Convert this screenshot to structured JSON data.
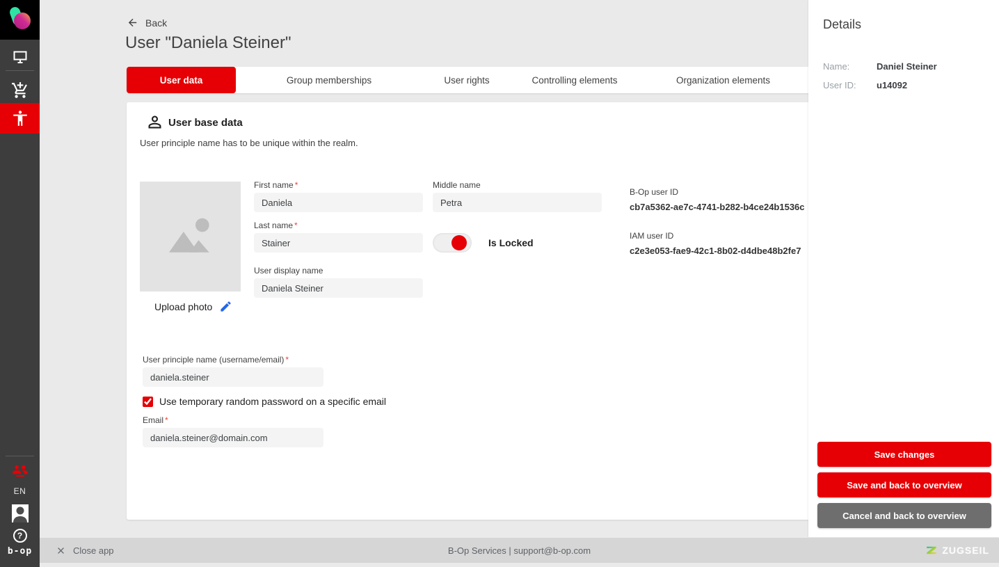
{
  "sidebar": {
    "language": "EN"
  },
  "header": {
    "back": "Back",
    "title": "User \"Daniela Steiner\""
  },
  "tabs": [
    {
      "label": "User data",
      "active": true
    },
    {
      "label": "Group memberships",
      "active": false
    },
    {
      "label": "User rights",
      "active": false
    },
    {
      "label": "Controlling elements",
      "active": false
    },
    {
      "label": "Organization elements",
      "active": false
    }
  ],
  "form": {
    "section_title": "User base data",
    "section_note": "User principle name has to be unique within the realm.",
    "upload_photo": "Upload photo",
    "required_marker": "*",
    "first_name": {
      "label": "First name",
      "value": "Daniela",
      "required": true
    },
    "middle_name": {
      "label": "Middle name",
      "value": "Petra",
      "required": false
    },
    "last_name": {
      "label": "Last name",
      "value": "Stainer",
      "required": true
    },
    "display_name": {
      "label": "User display name",
      "value": "Daniela Steiner",
      "required": false
    },
    "is_locked": {
      "label": "Is Locked",
      "on": true
    },
    "bop_user_id": {
      "label": "B-Op user ID",
      "value": "cb7a5362-ae7c-4741-b282-b4ce24b1536c"
    },
    "iam_user_id": {
      "label": "IAM user ID",
      "value": "c2e3e053-fae9-42c1-8b02-d4dbe48b2fe7"
    },
    "upn": {
      "label": "User principle name (username/email)",
      "value": "daniela.steiner",
      "required": true
    },
    "temp_password": {
      "label": "Use temporary random password on a specific email",
      "checked": true
    },
    "email": {
      "label": "Email",
      "value": "daniela.steiner@domain.com",
      "required": true
    }
  },
  "details": {
    "title": "Details",
    "rows": [
      {
        "label": "Name:",
        "value": "Daniel Steiner"
      },
      {
        "label": "User ID:",
        "value": "u14092"
      }
    ],
    "buttons": [
      {
        "label": "Save changes",
        "style": "primary"
      },
      {
        "label": "Save and back to overview",
        "style": "primary"
      },
      {
        "label": "Cancel and back to overview",
        "style": "secondary"
      }
    ]
  },
  "footer": {
    "close": "Close app",
    "center": "B-Op Services | support@b-op.com",
    "brand": "ZUGSEIL"
  },
  "colors": {
    "accent_red": "#e60005",
    "link_blue": "#1a73e8",
    "sidebar_dark": "#3d3d3d"
  }
}
